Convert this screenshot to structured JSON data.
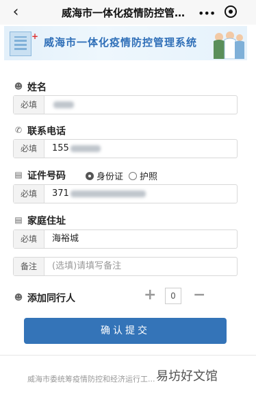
{
  "nav": {
    "title": "威海市一体化疫情防控管…",
    "back_icon": "chevron-left-icon",
    "more_icon": "more-dots-icon",
    "record_icon": "record-icon"
  },
  "banner": {
    "title": "威海市一体化疫情防控管理系统"
  },
  "form": {
    "name": {
      "label": "姓名",
      "tag": "必填",
      "value": ""
    },
    "phone": {
      "label": "联系电话",
      "tag": "必填",
      "value": "155"
    },
    "id": {
      "label": "证件号码",
      "tag": "必填",
      "value": "371",
      "options": [
        "身份证",
        "护照"
      ],
      "selected": "身份证"
    },
    "address": {
      "label": "家庭住址",
      "tag": "必填",
      "value": "海裕城"
    },
    "note": {
      "tag": "备注",
      "placeholder": "(选填)请填写备注"
    },
    "companions": {
      "label": "添加同行人",
      "count": "0",
      "plus": "+",
      "minus": "−"
    }
  },
  "submit": {
    "label": "确认提交"
  },
  "footer": {
    "text": "威海市委统筹疫情防控和经济运行工..."
  },
  "watermark": {
    "text": "易坊好文馆"
  },
  "colors": {
    "accent": "#3474b8",
    "banner_text": "#2f6fb8"
  }
}
